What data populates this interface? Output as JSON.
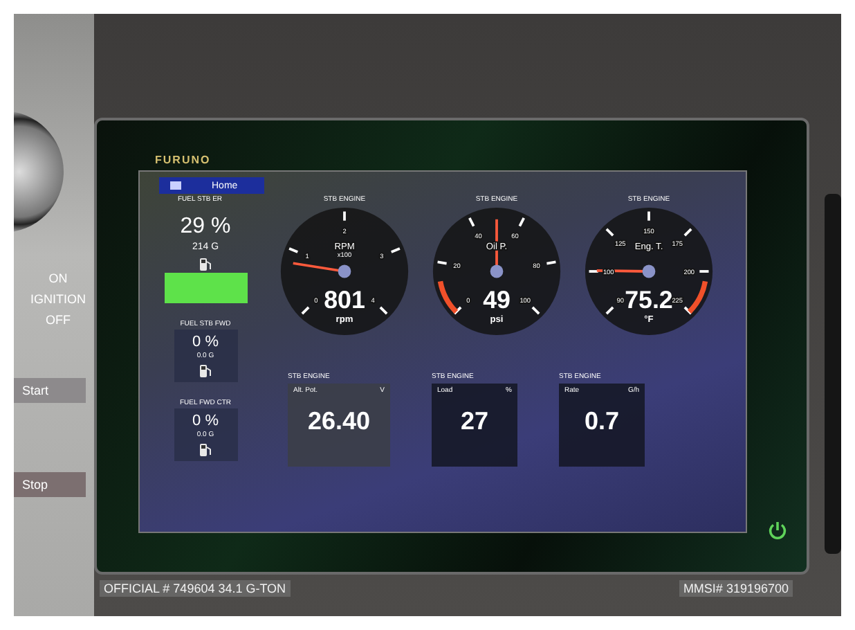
{
  "brand": "FURUNO",
  "panel": {
    "ignition": [
      "ON",
      "IGNITION",
      "OFF"
    ],
    "buttons": [
      "Start",
      "Stop"
    ]
  },
  "screen": {
    "home_button": "Home",
    "tanks": [
      {
        "kind": "large",
        "title": "FUEL STB ER",
        "percent": "29 %",
        "volume": "214 G"
      },
      {
        "kind": "small",
        "title": "FUEL STB FWD",
        "percent": "0 %",
        "volume": "0.0 G"
      },
      {
        "kind": "small",
        "title": "FUEL FWD CTR",
        "percent": "0 %",
        "volume": "0.0 G"
      }
    ],
    "gauges": [
      {
        "title": "STB ENGINE",
        "label": "RPM",
        "sublabel": "x100",
        "scale": [
          "0",
          "1",
          "2",
          "3",
          "4"
        ],
        "level": 0.2,
        "value": "801",
        "unit": "rpm"
      },
      {
        "title": "STB ENGINE",
        "label": "Oil P.",
        "scale": [
          "0",
          "20",
          "40",
          "60",
          "80",
          "100"
        ],
        "level": 0.5,
        "value": "49",
        "unit": "psi",
        "warning_low": true
      },
      {
        "title": "STB ENGINE",
        "label": "Eng. T.",
        "scale": [
          "90",
          "100",
          "125",
          "150",
          "175",
          "200",
          "225"
        ],
        "level": 0.17,
        "value": "75.2",
        "unit": "°F",
        "warning_high": true
      }
    ],
    "readouts": [
      {
        "title": "STB ENGINE",
        "label": "Alt. Pot.",
        "unit": "V",
        "value": "26.40"
      },
      {
        "title": "STB ENGINE",
        "label": "Load",
        "unit": "%",
        "value": "27"
      },
      {
        "title": "STB ENGINE",
        "label": "Rate",
        "unit": "G/h",
        "value": "0.7"
      }
    ]
  },
  "plate": {
    "official": "OFFICIAL # 749604 34.1 G-TON",
    "mmsi": "MMSI# 319196700"
  }
}
